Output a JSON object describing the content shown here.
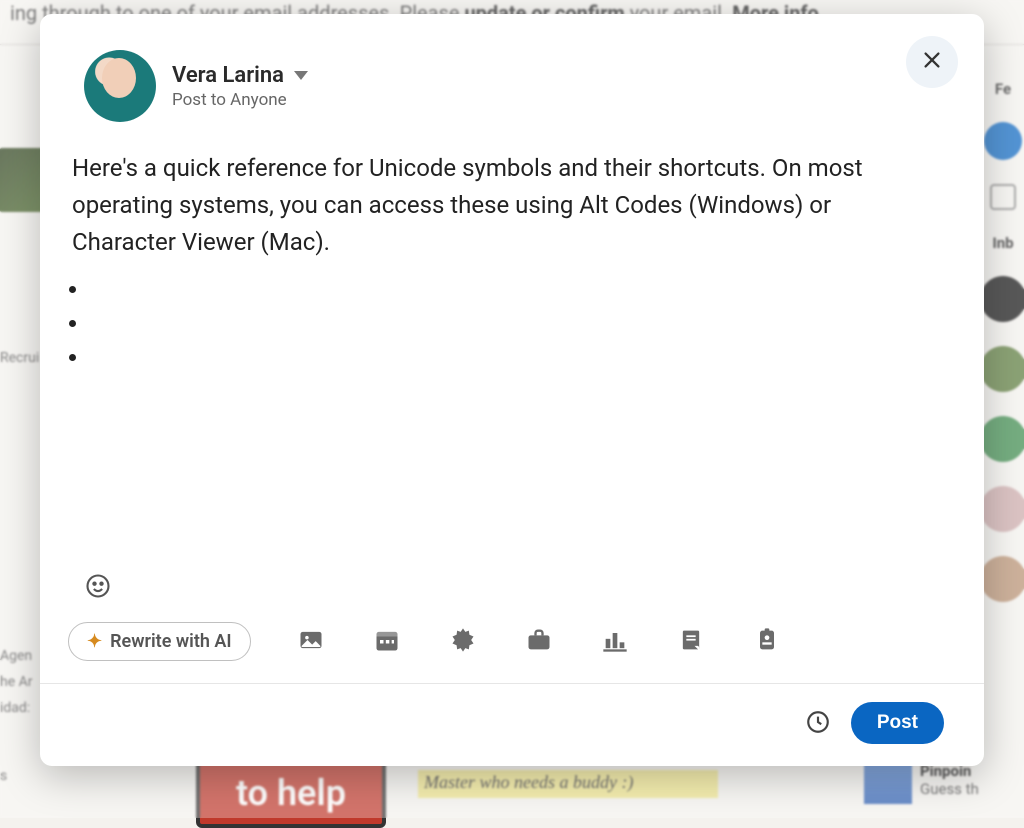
{
  "background": {
    "banner_prefix": "ing through to one of your email addresses. Please ",
    "banner_bold1": "update or confirm",
    "banner_mid": " your email. ",
    "banner_bold2": "More info",
    "left_labels": {
      "recrui": "Recrui",
      "agen": "Agen",
      "he_ar": "he Ar",
      "idad": "idad:",
      "s": "s"
    },
    "to_help": "to help",
    "note": "Master who needs a buddy :)",
    "right": {
      "fe": "Fe",
      "inb": "Inb"
    },
    "pinpoin": {
      "title": "Pinpoin",
      "sub": "Guess th"
    }
  },
  "modal": {
    "author": {
      "name": "Vera Larina",
      "audience": "Post to Anyone"
    },
    "body": {
      "paragraph": "Here's a quick reference for Unicode symbols and their shortcuts. On most operating systems, you can access these using Alt Codes (Windows) or Character Viewer (Mac).",
      "bullets": [
        "",
        "",
        ""
      ]
    },
    "toolbar": {
      "rewrite_label": "Rewrite with AI",
      "icons": [
        "image",
        "calendar",
        "starburst",
        "briefcase",
        "poll",
        "document",
        "id-badge"
      ]
    },
    "footer": {
      "post_label": "Post"
    }
  }
}
